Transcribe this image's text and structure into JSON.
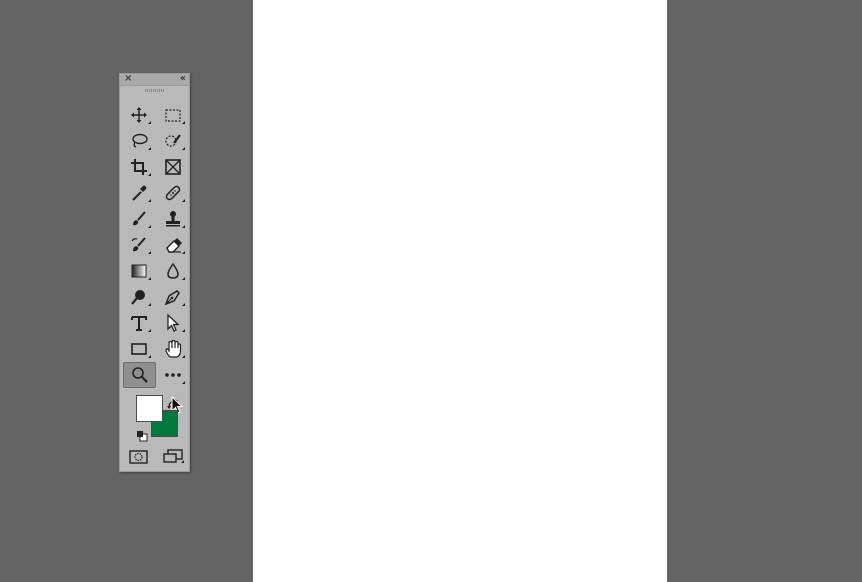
{
  "window": {
    "workspace_bg": "#646464",
    "document_bg": "#ffffff"
  },
  "toolbox": {
    "close_glyph": "×",
    "collapse_glyph": "‹‹",
    "tools": [
      {
        "name": "move-tool",
        "icon": "move-icon"
      },
      {
        "name": "rectangular-marquee-tool",
        "icon": "marquee-icon"
      },
      {
        "name": "lasso-tool",
        "icon": "lasso-icon"
      },
      {
        "name": "quick-selection-tool",
        "icon": "quick-selection-icon"
      },
      {
        "name": "crop-tool",
        "icon": "crop-icon"
      },
      {
        "name": "frame-tool",
        "icon": "frame-icon"
      },
      {
        "name": "eyedropper-tool",
        "icon": "eyedropper-icon"
      },
      {
        "name": "healing-brush-tool",
        "icon": "bandage-icon"
      },
      {
        "name": "brush-tool",
        "icon": "brush-icon"
      },
      {
        "name": "clone-stamp-tool",
        "icon": "stamp-icon"
      },
      {
        "name": "history-brush-tool",
        "icon": "history-brush-icon"
      },
      {
        "name": "eraser-tool",
        "icon": "eraser-icon"
      },
      {
        "name": "gradient-tool",
        "icon": "gradient-icon"
      },
      {
        "name": "blur-tool",
        "icon": "droplet-icon"
      },
      {
        "name": "dodge-tool",
        "icon": "dodge-icon"
      },
      {
        "name": "pen-tool",
        "icon": "pen-icon"
      },
      {
        "name": "type-tool",
        "icon": "type-icon"
      },
      {
        "name": "path-selection-tool",
        "icon": "arrow-icon"
      },
      {
        "name": "rectangle-tool",
        "icon": "rectangle-icon"
      },
      {
        "name": "hand-tool",
        "icon": "hand-icon"
      },
      {
        "name": "zoom-tool",
        "icon": "zoom-icon",
        "active": true
      },
      {
        "name": "edit-toolbar",
        "icon": "more-icon"
      }
    ],
    "foreground_color": "#ffffff",
    "background_color": "#007a3d",
    "type_label": "T"
  }
}
